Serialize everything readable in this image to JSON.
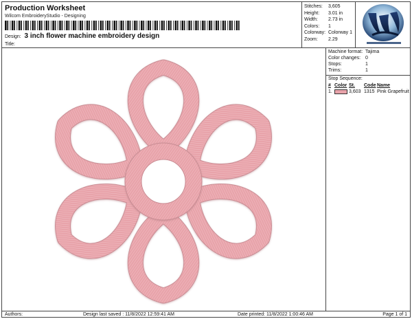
{
  "header": {
    "title": "Production Worksheet",
    "subtitle": "Wilcom EmbroideryStudio - Designing",
    "design_label": "Design:",
    "design_name": "3 inch flower machine embroidery design",
    "title_label": "Title:"
  },
  "stats": [
    {
      "key": "Stitches:",
      "value": "3,605"
    },
    {
      "key": "Height:",
      "value": "3.01 in"
    },
    {
      "key": "Width:",
      "value": "2.73 in"
    },
    {
      "key": "Colors:",
      "value": "1"
    },
    {
      "key": "Colorway:",
      "value": "Colorway 1"
    },
    {
      "key": "Zoom:",
      "value": "2.29"
    }
  ],
  "machine": [
    {
      "key": "Machine format:",
      "value": "Tajima"
    },
    {
      "key": "Color changes:",
      "value": "0"
    },
    {
      "key": "Stops:",
      "value": "1"
    },
    {
      "key": "Trims:",
      "value": "1"
    }
  ],
  "sequence": {
    "title": "Stop Sequence:",
    "headers": [
      "#",
      "Color",
      "St.",
      "Code",
      "Name"
    ],
    "rows": [
      {
        "num": "1.",
        "color": "#e8a3aa",
        "stitches": "3,603",
        "code": "1315",
        "name": "Pink Grapefruit"
      }
    ]
  },
  "footer": {
    "authors": "Authors:",
    "saved": "Design last saved : 11/8/2022 12:59:41 AM",
    "printed": "Date printed: 11/8/2022 1:00:46 AM",
    "page": "Page 1 of 1"
  },
  "colors": {
    "thread": "#e8a3aa",
    "thread_shadow": "#c98d94",
    "thread_light": "#f2c3c7"
  }
}
